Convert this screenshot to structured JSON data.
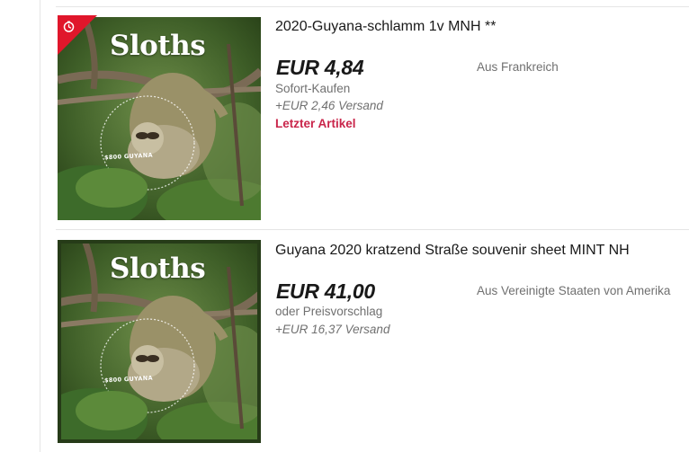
{
  "listings": [
    {
      "title": "2020-Guyana-schlamm 1v MNH **",
      "price": "EUR 4,84",
      "buy_format": "Sofort-Kaufen",
      "shipping": "+EUR 2,46 Versand",
      "urgency": "Letzter Artikel",
      "origin": "Aus Frankreich",
      "image": {
        "caption": "Sloths",
        "value": "$800 GUYANA",
        "badge_icon": "stopwatch-icon"
      }
    },
    {
      "title": "Guyana 2020 kratzend Straße souvenir sheet MINT NH",
      "price": "EUR 41,00",
      "buy_format": "oder Preisvorschlag",
      "shipping": "+EUR 16,37 Versand",
      "origin": "Aus Vereinigte Staaten von Amerika",
      "image": {
        "caption": "Sloths",
        "value": "$800 GUYANA"
      }
    }
  ],
  "colors": {
    "urgency": "#c9254a",
    "badge": "#e0162b",
    "muted_text": "#707070"
  }
}
